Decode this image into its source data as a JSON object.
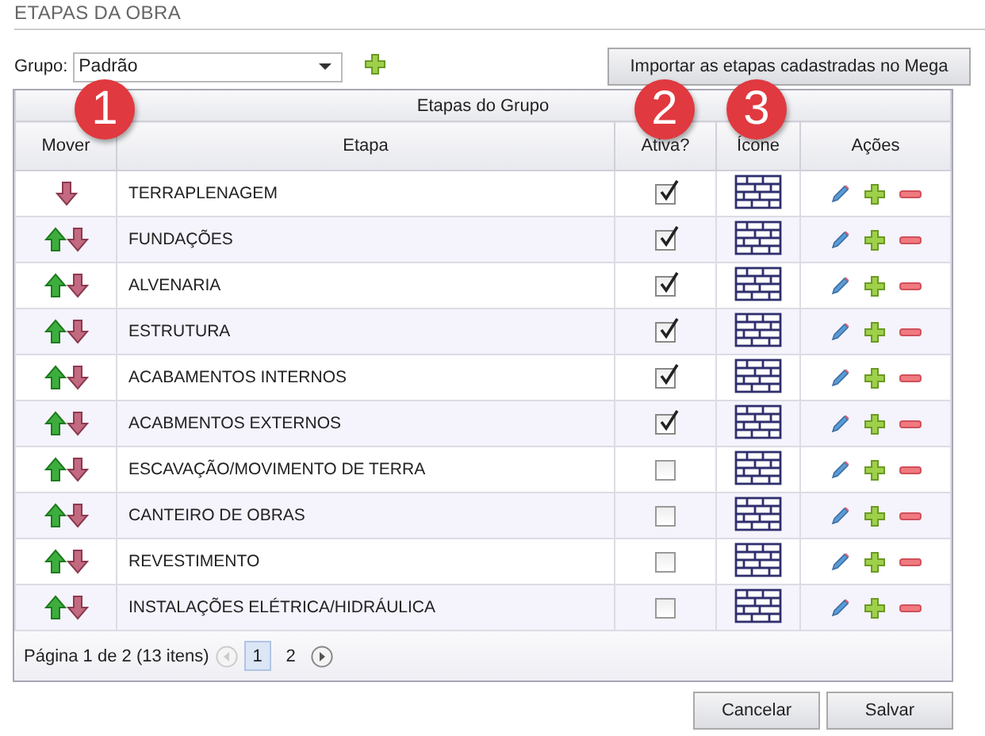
{
  "page_title": "ETAPAS DA OBRA",
  "group": {
    "label": "Grupo:",
    "value": "Padrão"
  },
  "import_button": "Importar as etapas cadastradas no Mega",
  "table": {
    "caption": "Etapas do Grupo",
    "columns": [
      "Mover",
      "Etapa",
      "Ativa?",
      "Ícone",
      "Ações"
    ],
    "rows": [
      {
        "etapa": "TERRAPLENAGEM",
        "can_move_up": false,
        "active": true
      },
      {
        "etapa": "FUNDAÇÕES",
        "can_move_up": true,
        "active": true
      },
      {
        "etapa": "ALVENARIA",
        "can_move_up": true,
        "active": true
      },
      {
        "etapa": "ESTRUTURA",
        "can_move_up": true,
        "active": true
      },
      {
        "etapa": "ACABAMENTOS INTERNOS",
        "can_move_up": true,
        "active": true
      },
      {
        "etapa": "ACABMENTOS EXTERNOS",
        "can_move_up": true,
        "active": true
      },
      {
        "etapa": "ESCAVAÇÃO/MOVIMENTO DE TERRA",
        "can_move_up": true,
        "active": false
      },
      {
        "etapa": "CANTEIRO DE OBRAS",
        "can_move_up": true,
        "active": false
      },
      {
        "etapa": "REVESTIMENTO",
        "can_move_up": true,
        "active": false
      },
      {
        "etapa": "INSTALAÇÕES ELÉTRICA/HIDRÁULICA",
        "can_move_up": true,
        "active": false
      }
    ]
  },
  "pager": {
    "summary": "Página 1 de 2 (13 itens)",
    "pages": [
      {
        "label": "1",
        "selected": true
      },
      {
        "label": "2",
        "selected": false
      }
    ]
  },
  "buttons": [
    "Cancelar",
    "Salvar"
  ],
  "callouts": [
    "1",
    "2",
    "3"
  ]
}
